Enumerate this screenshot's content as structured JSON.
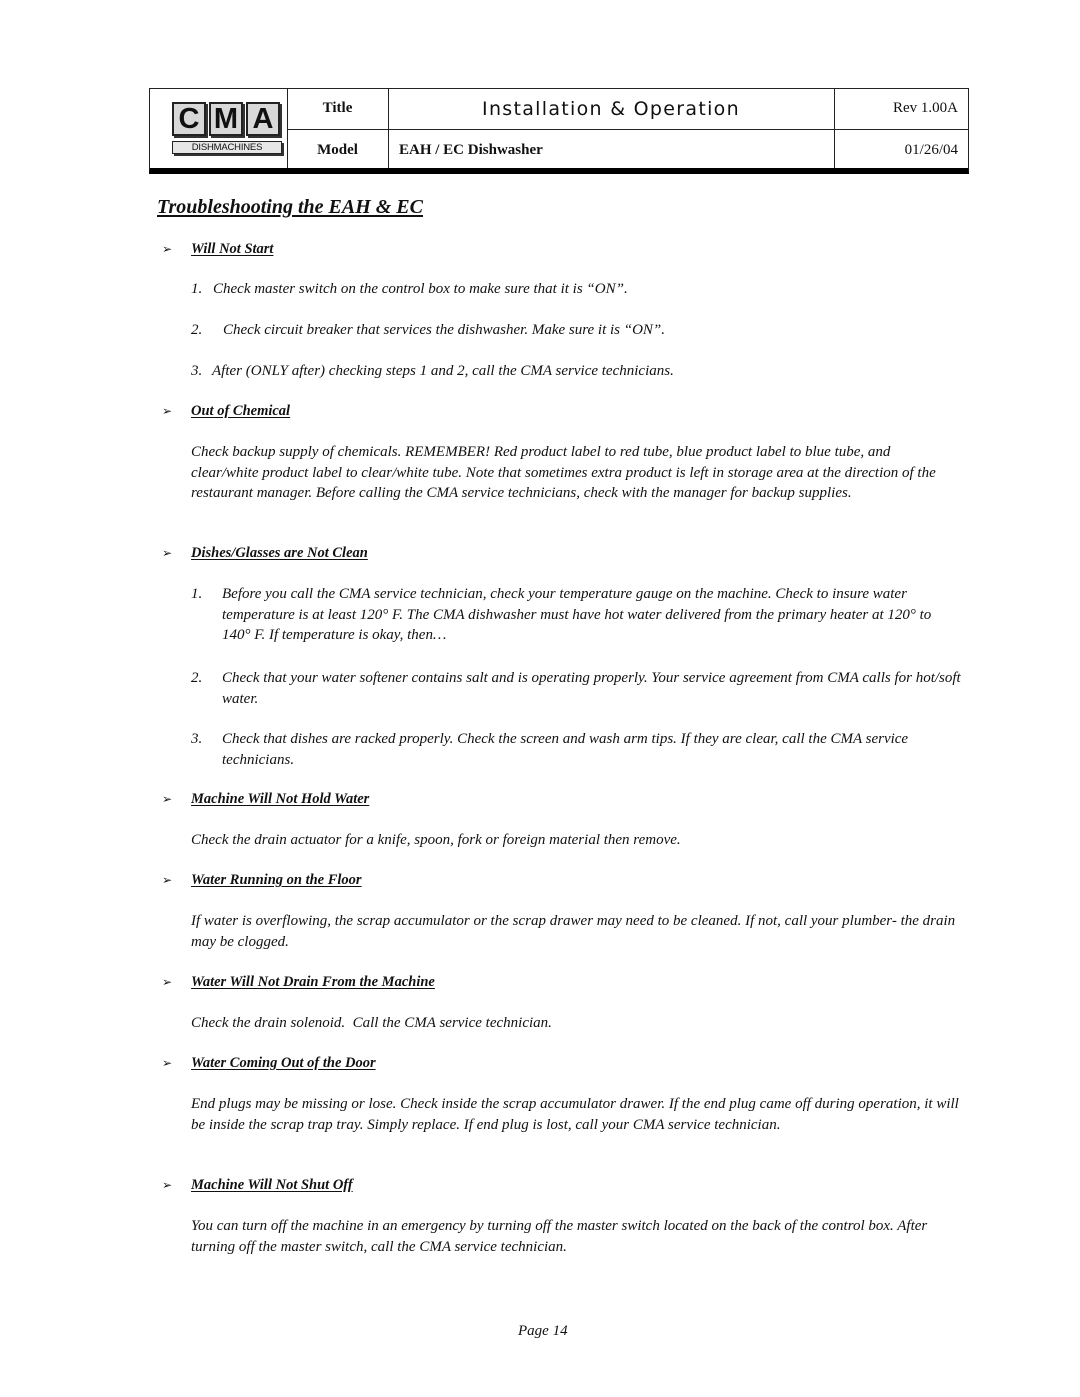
{
  "header": {
    "logo": {
      "letters": [
        "C",
        "M",
        "A"
      ],
      "subtitle": "DISHMACHINES"
    },
    "title_label": "Title",
    "title_value": "Installation & Operation",
    "model_label": "Model",
    "model_value": "EAH / EC Dishwasher",
    "revision": "Rev 1.00A",
    "date": "01/26/04"
  },
  "section_title": "Troubleshooting the EAH & EC",
  "bullet_icon": "arrow-bullet-icon",
  "bullet_glyph": "➢",
  "sections": [
    {
      "heading": "Will Not Start",
      "items": [
        {
          "num": "1.",
          "text": "Check master switch on the control box to make sure that it is “ON”."
        },
        {
          "num": "2.",
          "text": "Check circuit breaker that services the dishwasher. Make sure it is “ON”."
        },
        {
          "num": "3.",
          "text": "After (ONLY after) checking steps 1 and 2, call the CMA service technicians."
        }
      ]
    },
    {
      "heading": "Out of Chemical",
      "paragraph": "Check backup supply of chemicals. REMEMBER! Red product label to red tube, blue product label to blue tube, and clear/white product label to clear/white tube. Note that sometimes extra product is left in storage area at the direction of the restaurant manager. Before calling the CMA service technicians, check with the manager for backup supplies."
    },
    {
      "heading": "Dishes/Glasses are Not Clean",
      "items": [
        {
          "num": "1.",
          "text": "Before you call the CMA service technician, check your temperature gauge on the machine. Check to insure water temperature is at least 120° F. The CMA dishwasher must have hot water delivered from the primary heater at 120° to 140° F. If temperature is okay, then…"
        },
        {
          "num": "2.",
          "text": "Check that your water softener contains salt and is operating properly. Your service agreement from CMA calls for hot/soft water."
        },
        {
          "num": "3.",
          "text": "Check that dishes are racked properly. Check the screen and wash arm tips. If they are clear, call the CMA service technicians."
        }
      ]
    },
    {
      "heading": "Machine Will Not Hold Water",
      "paragraph": "Check the drain actuator for a knife, spoon, fork or foreign material then remove."
    },
    {
      "heading": "Water Running on the Floor",
      "paragraph": "If water is overflowing, the scrap accumulator or the scrap drawer may need to be cleaned. If not, call your plumber- the drain may be clogged."
    },
    {
      "heading": "Water Will Not Drain From the Machine",
      "paragraph": "Check the drain solenoid.  Call the CMA service technician."
    },
    {
      "heading": "Water Coming Out of the Door",
      "paragraph": "End plugs may be missing or lose.  Check inside the scrap accumulator drawer. If the end plug came off during operation, it will be inside the scrap trap tray. Simply replace. If end plug is lost, call your CMA service technician."
    },
    {
      "heading": "Machine Will Not Shut Off",
      "paragraph": "You can turn off the machine in an emergency by turning off the master switch located on the back of the control box. After turning off the master switch, call the CMA service technician."
    }
  ],
  "footer": {
    "page": "Page 14"
  }
}
